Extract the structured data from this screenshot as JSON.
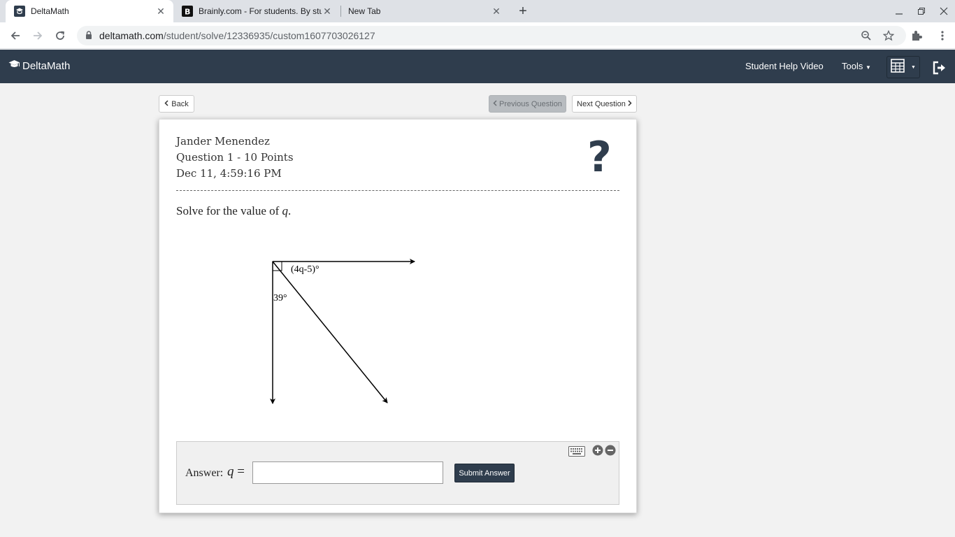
{
  "browser": {
    "tabs": [
      {
        "title": "DeltaMath",
        "active": true
      },
      {
        "title": "Brainly.com - For students. By stu",
        "active": false
      },
      {
        "title": "New Tab",
        "active": false
      }
    ],
    "url_host": "deltamath.com",
    "url_path": "/student/solve/12336935/custom1607703026127"
  },
  "app": {
    "brand": "DeltaMath",
    "help_link": "Student Help Video",
    "tools_label": "Tools"
  },
  "controls": {
    "back": "Back",
    "prev": "Previous Question",
    "next": "Next Question"
  },
  "question": {
    "student": "Jander Menendez",
    "title": "Question 1 - 10 Points",
    "datetime": "Dec 11, 4:59:16 PM",
    "help_symbol": "?",
    "prompt_pre": "Solve for the value of ",
    "prompt_var": "q",
    "prompt_post": ".",
    "figure": {
      "angle_label_1": "(4q-5)°",
      "angle_label_2": "39°"
    }
  },
  "answer": {
    "label": "Answer:",
    "variable": "q",
    "equals": "=",
    "value": "",
    "submit": "Submit Answer"
  },
  "colors": {
    "nav_bg": "#2f3d4d",
    "page_bg": "#f2f2f2"
  }
}
